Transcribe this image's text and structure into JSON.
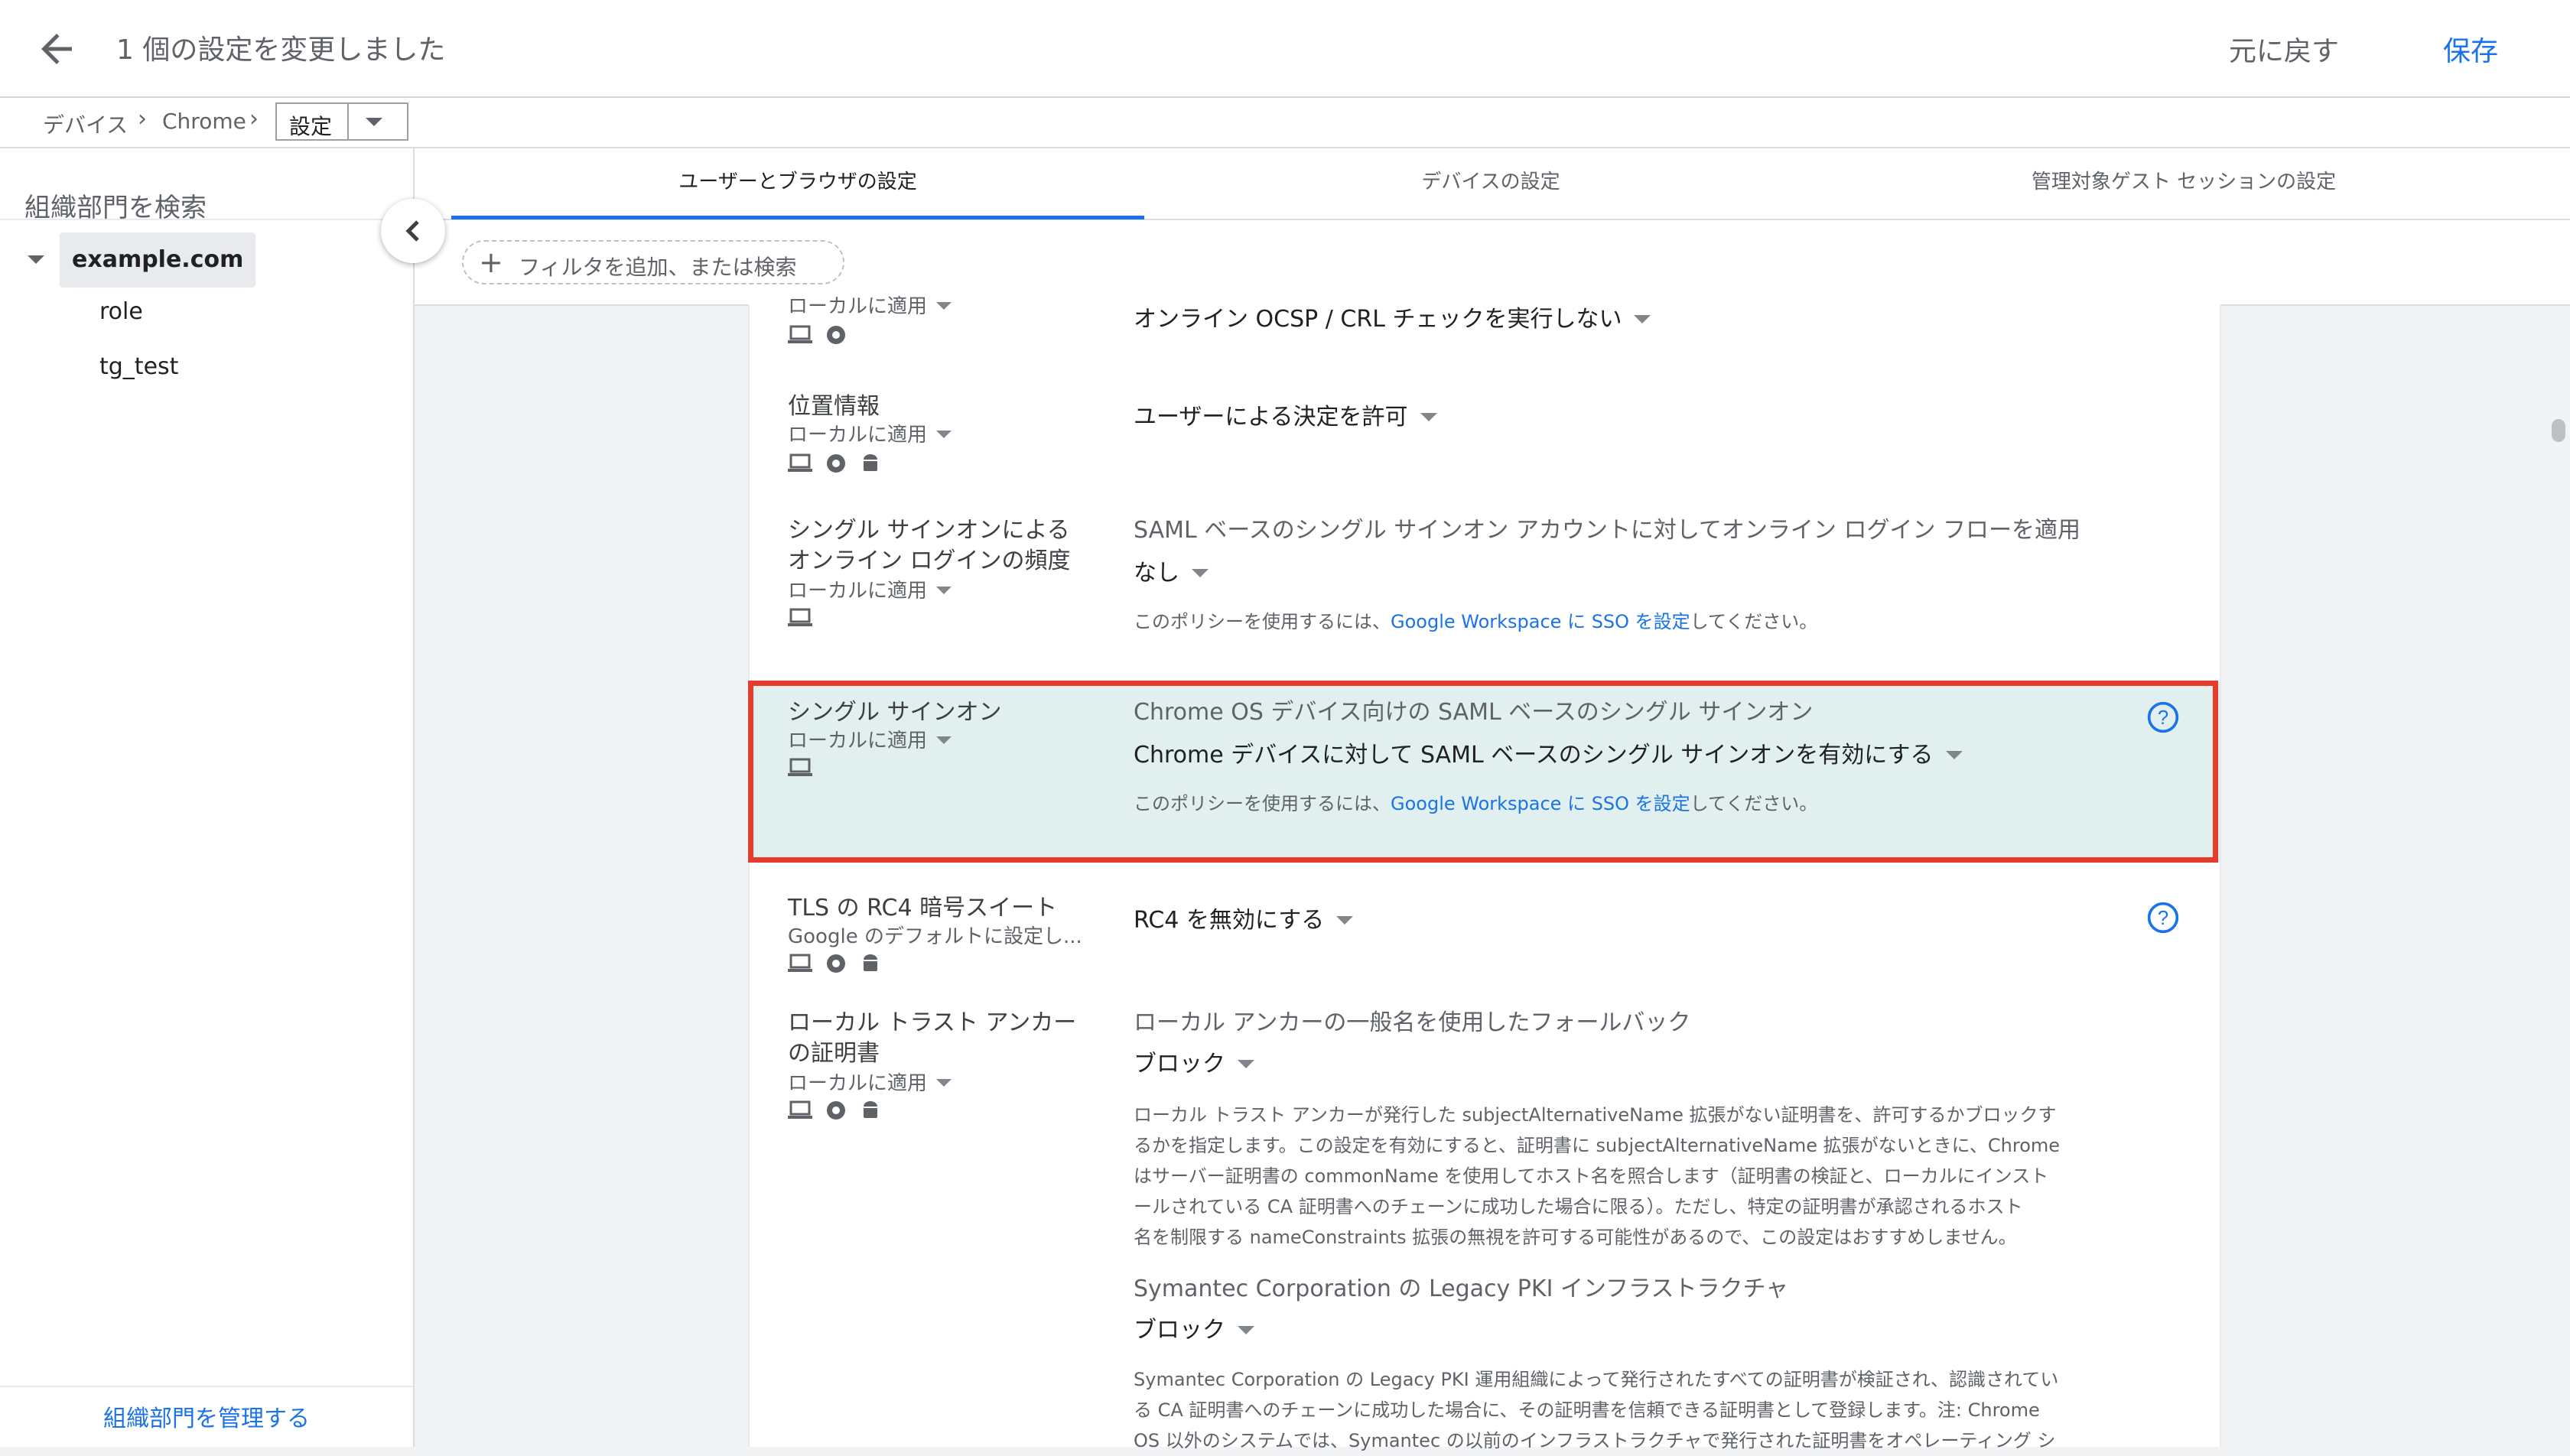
{
  "header": {
    "title": "1 個の設定を変更しました",
    "revert_label": "元に戻す",
    "save_label": "保存"
  },
  "breadcrumb": {
    "items": [
      "デバイス",
      "Chrome"
    ],
    "current": "設定"
  },
  "sidebar": {
    "search_placeholder": "組織部門を検索",
    "root": "example.com",
    "children": [
      "role",
      "tg_test"
    ],
    "manage_link": "組織部門を管理する"
  },
  "tabs": [
    {
      "label": "ユーザーとブラウザの設定",
      "active": true
    },
    {
      "label": "デバイスの設定",
      "active": false
    },
    {
      "label": "管理対象ゲスト セッションの設定",
      "active": false
    }
  ],
  "filter": {
    "placeholder": "フィルタを追加、または検索"
  },
  "settings": [
    {
      "name": "",
      "applied": "ローカルに適用",
      "icons": [
        "laptop-icon",
        "chrome-icon"
      ],
      "value": "オンライン OCSP / CRL チェックを実行しない"
    },
    {
      "name": "位置情報",
      "applied": "ローカルに適用",
      "icons": [
        "laptop-icon",
        "chrome-icon",
        "android-icon"
      ],
      "value": "ユーザーによる決定を許可"
    },
    {
      "name_line1": "シングル サインオンによる",
      "name_line2": "オンライン ログインの頻度",
      "applied": "ローカルに適用",
      "icons": [
        "laptop-icon"
      ],
      "value_label": "SAML ベースのシングル サインオン アカウントに対してオンライン ログイン フローを適用",
      "value": "なし",
      "note_pre": "このポリシーを使用するには、",
      "note_link": "Google Workspace に SSO を設定",
      "note_post": "してください。"
    },
    {
      "name": "シングル サインオン",
      "applied": "ローカルに適用",
      "icons": [
        "laptop-icon"
      ],
      "value_label": "Chrome OS デバイス向けの SAML ベースのシングル サインオン",
      "value": "Chrome デバイスに対して SAML ベースのシングル サインオンを有効にする",
      "note_pre": "このポリシーを使用するには、",
      "note_link": "Google Workspace に SSO を設定",
      "note_post": "してください。",
      "highlighted": true
    },
    {
      "name": "TLS の RC4 暗号スイート",
      "applied": "Google のデフォルトに設定し...",
      "icons": [
        "laptop-icon",
        "chrome-icon",
        "android-icon"
      ],
      "value": "RC4 を無効にする"
    },
    {
      "name_line1": "ローカル トラスト アンカー",
      "name_line2": "の証明書",
      "applied": "ローカルに適用",
      "icons": [
        "laptop-icon",
        "chrome-icon",
        "android-icon"
      ],
      "value_label": "ローカル アンカーの一般名を使用したフォールバック",
      "value": "ブロック",
      "description": [
        "ローカル トラスト アンカーが発行した subjectAlternativeName 拡張がない証明書を、許可するかブロックす",
        "るかを指定します。この設定を有効にすると、証明書に subjectAlternativeName 拡張がないときに、Chrome",
        "はサーバー証明書の commonName を使用してホスト名を照合します（証明書の検証と、ローカルにインスト",
        "ールされている CA 証明書へのチェーンに成功した場合に限る）。ただし、特定の証明書が承認されるホスト",
        "名を制限する nameConstraints 拡張の無視を許可する可能性があるので、この設定はおすすめしません。"
      ],
      "value2_label": "Symantec Corporation の Legacy PKI インフラストラクチャ",
      "value2": "ブロック",
      "description2": [
        "Symantec Corporation の Legacy PKI 運用組織によって発行されたすべての証明書が検証され、認識されてい",
        "る CA 証明書へのチェーンに成功した場合に、その証明書を信頼できる証明書として登録します。注: Chrome",
        "OS 以外のシステムでは、Symantec の以前のインフラストラクチャで発行された証明書をオペレーティング シ"
      ]
    }
  ],
  "colors": {
    "accent": "#1a73e8",
    "highlight_bg": "#e1f0ef",
    "highlight_border": "#e53c2b"
  }
}
